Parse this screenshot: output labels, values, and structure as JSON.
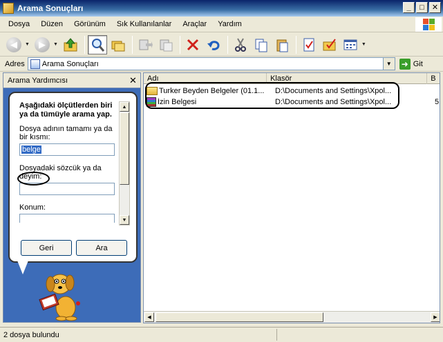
{
  "window": {
    "title": "Arama Sonuçları"
  },
  "menu": [
    "Dosya",
    "Düzen",
    "Görünüm",
    "Sık Kullanılanlar",
    "Araçlar",
    "Yardım"
  ],
  "address": {
    "label": "Adres",
    "value": "Arama Sonuçları",
    "go_label": "Git"
  },
  "search_panel": {
    "header": "Arama Yardımcısı",
    "heading": "Aşağıdaki ölçütlerden biri ya da tümüyle arama yap.",
    "filename_label": "Dosya adının tamamı ya da bir kısmı:",
    "filename_value": "belge",
    "word_label": "Dosyadaki sözcük ya da deyim:",
    "word_value": "",
    "location_label": "Konum:",
    "back_button": "Geri",
    "search_button": "Ara"
  },
  "results": {
    "columns": [
      "Adı",
      "Klasör",
      "B"
    ],
    "rows": [
      {
        "name": "Turker Beyden Belgeler (01.1...",
        "folder": "D:\\Documents and Settings\\Xpol...",
        "extra": "",
        "icon": "folder-icon"
      },
      {
        "name": "İzin Belgesi",
        "folder": "D:\\Documents and Settings\\Xpol...",
        "extra": "5",
        "icon": "rar-archive-icon"
      }
    ]
  },
  "status": {
    "text": "2 dosya bulundu"
  }
}
